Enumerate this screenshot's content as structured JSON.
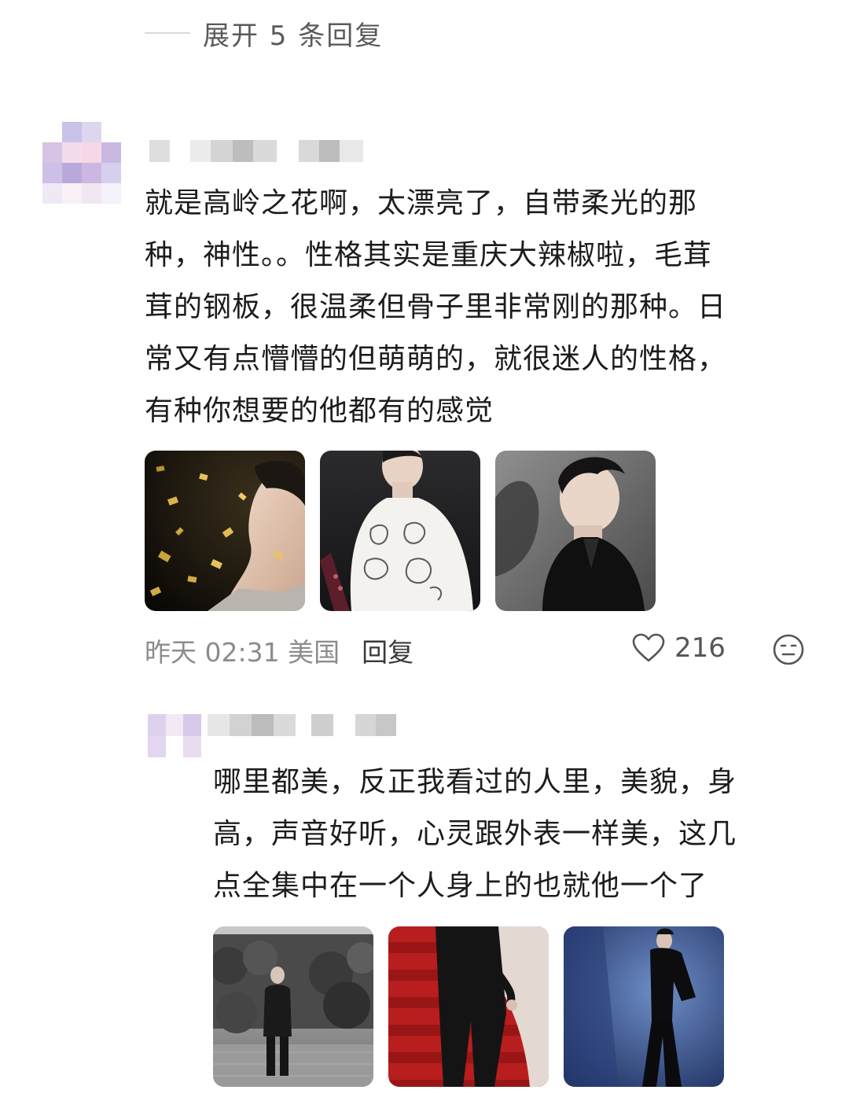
{
  "expand_replies": {
    "label": "展开 5 条回复"
  },
  "comment": {
    "text": "就是高岭之花啊，太漂亮了，自带柔光的那\n种，神性。。性格其实是重庆大辣椒啦，毛茸\n茸的钢板，很温柔但骨子里非常刚的那种。日\n常又有点懵懵的但萌萌的，就很迷人的性格，\n有种你想要的他都有的感觉",
    "images": [
      "gold-confetti-portrait",
      "white-embroidered-shirt",
      "black-suit-shadow-profile"
    ],
    "time": "昨天 02:31 美国",
    "reply_label": "回复",
    "like_count": "216",
    "icons": {
      "like": "heart-outline-icon",
      "emoji": "emoji-icon"
    }
  },
  "reply": {
    "text": "哪里都美，反正我看过的人里，美貌，身\n高，声音好听，心灵跟外表一样美，这几\n点全集中在一个人身上的也就他一个了",
    "images": [
      "suit-garden-photo",
      "red-carpet-stairs",
      "blue-stage-pose"
    ]
  }
}
